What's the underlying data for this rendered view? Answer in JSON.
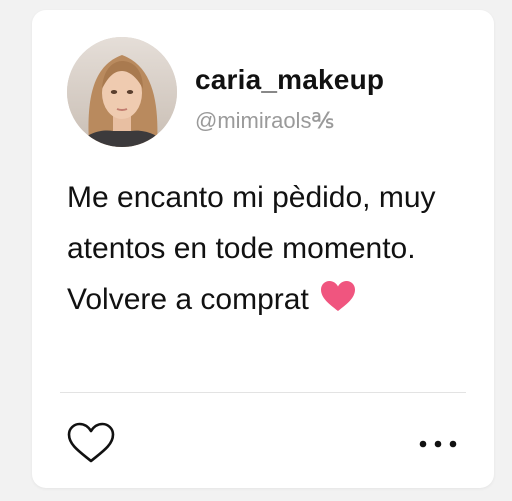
{
  "post": {
    "username": "caria_makeup",
    "handle": "@mimiraols℁",
    "text": "Me encanto mi pèdido, muy atentos en tode momento. Volvere a comprat",
    "emoji": "pink-heart-icon"
  },
  "actions": {
    "like_icon": "heart-outline-icon",
    "more_icon": "more-horizontal-icon"
  },
  "colors": {
    "background": "#f2f2f2",
    "card": "#ffffff",
    "username": "#111111",
    "handle": "#9a9a9a",
    "heart": "#f0557f"
  }
}
